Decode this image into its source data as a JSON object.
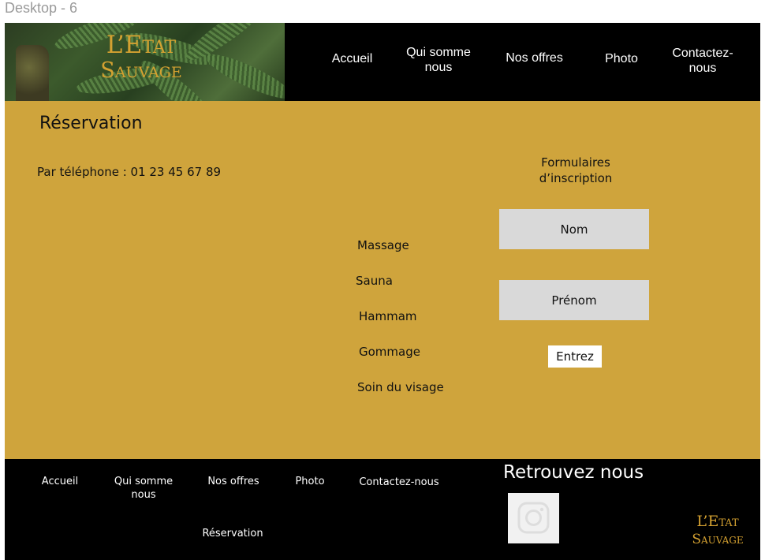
{
  "frame_label": "Desktop - 6",
  "brand": {
    "line1": "L’Etat",
    "line2": "Sauvage"
  },
  "header_nav": [
    {
      "label": "Accueil"
    },
    {
      "label": "Qui somme nous"
    },
    {
      "label": "Nos offres"
    },
    {
      "label": "Photo"
    },
    {
      "label": "Contactez-nous"
    }
  ],
  "main": {
    "title": "Réservation",
    "phone": "Par téléphone : 01 23 45 67 89",
    "form_title": "Formulaires d’inscription",
    "services": [
      "Massage",
      "Sauna",
      "Hammam",
      "Gommage",
      "Soin du visage"
    ],
    "fields": {
      "nom": "Nom",
      "prenom": "Prénom"
    },
    "submit_label": "Entrez"
  },
  "footer": {
    "links": [
      "Accueil",
      "Qui somme nous",
      "Nos offres",
      "Photo",
      "Contactez-nous",
      "Réservation"
    ],
    "follow_title": "Retrouvez nous",
    "social_icon": "instagram-icon",
    "brand": {
      "line1": "L’Etat",
      "line2": "Sauvage"
    }
  },
  "colors": {
    "main_bg": "#cfa43c",
    "header_bg": "#000000",
    "brand_gold": "#d4a131",
    "field_bg": "#d9d9d9"
  }
}
